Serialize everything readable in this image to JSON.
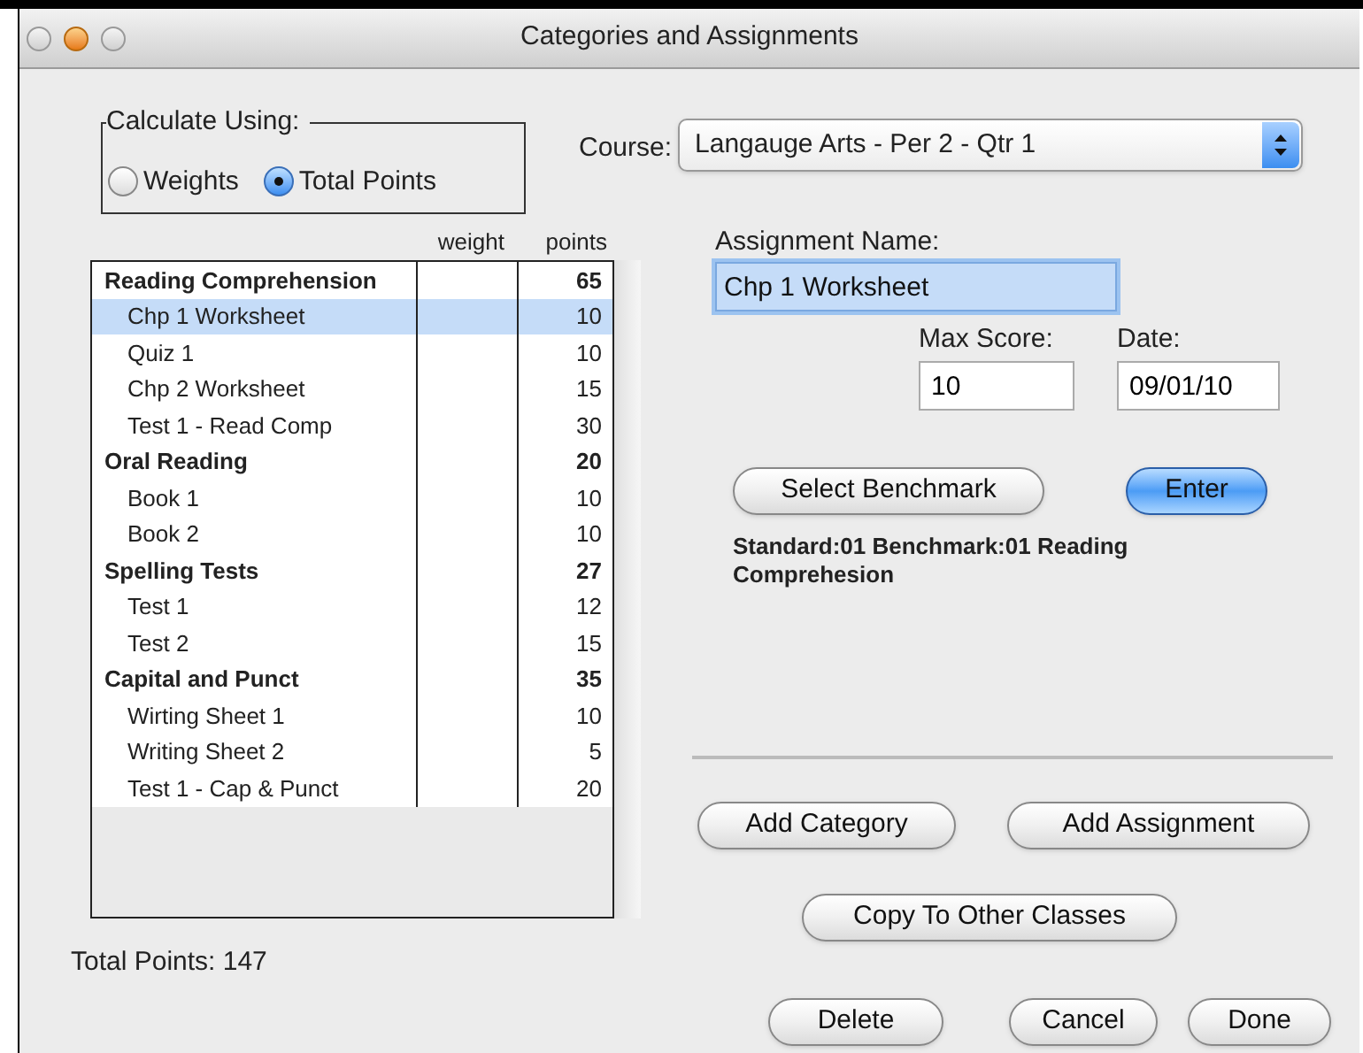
{
  "window": {
    "title": "Categories and Assignments"
  },
  "calculate_using": {
    "label": "Calculate Using:",
    "options": [
      {
        "label": "Weights",
        "selected": false
      },
      {
        "label": "Total Points",
        "selected": true
      }
    ]
  },
  "course": {
    "label": "Course:",
    "value": "Langauge Arts - Per 2 - Qtr 1"
  },
  "table": {
    "columns": [
      "weight",
      "points"
    ],
    "rows": [
      {
        "name": "Reading Comprehension",
        "points": "65",
        "selected": false,
        "children": [
          {
            "name": "Chp 1 Worksheet",
            "points": "10",
            "selected": true
          },
          {
            "name": "Quiz 1",
            "points": "10",
            "selected": false
          },
          {
            "name": "Chp 2 Worksheet",
            "points": "15",
            "selected": false
          },
          {
            "name": "Test 1 - Read Comp",
            "points": "30",
            "selected": false
          }
        ]
      },
      {
        "name": "Oral Reading",
        "points": "20",
        "selected": false,
        "children": [
          {
            "name": "Book 1",
            "points": "10",
            "selected": false
          },
          {
            "name": "Book 2",
            "points": "10",
            "selected": false
          }
        ]
      },
      {
        "name": "Spelling Tests",
        "points": "27",
        "selected": false,
        "children": [
          {
            "name": "Test 1",
            "points": "12",
            "selected": false
          },
          {
            "name": "Test 2",
            "points": "15",
            "selected": false
          }
        ]
      },
      {
        "name": "Capital and Punct",
        "points": "35",
        "selected": false,
        "children": [
          {
            "name": "Wirting Sheet 1",
            "points": "10",
            "selected": false
          },
          {
            "name": "Writing Sheet 2",
            "points": "5",
            "selected": false
          },
          {
            "name": "Test 1 - Cap & Punct",
            "points": "20",
            "selected": false
          }
        ]
      }
    ]
  },
  "total_points": "Total Points: 147",
  "assignment_name": {
    "label": "Assignment Name:",
    "value": "Chp 1 Worksheet",
    "focused": true
  },
  "max_score": {
    "label": "Max Score:",
    "value": "10"
  },
  "date": {
    "label": "Date:",
    "value": "09/01/10"
  },
  "benchmark_buttons": [
    {
      "label": "Select Benchmark",
      "default": false
    },
    {
      "label": "Enter",
      "default": true
    }
  ],
  "benchmark_text": "Standard:01  Benchmark:01 Reading Comprehesion",
  "add_buttons": [
    {
      "label": "Add Category",
      "default": false
    },
    {
      "label": "Add Assignment",
      "default": false
    }
  ],
  "copy_button": {
    "label": "Copy To Other Classes",
    "default": false
  },
  "bottom_buttons": [
    {
      "label": "Delete",
      "default": false
    },
    {
      "label": "Cancel",
      "default": false
    },
    {
      "label": "Done",
      "default": false
    }
  ]
}
